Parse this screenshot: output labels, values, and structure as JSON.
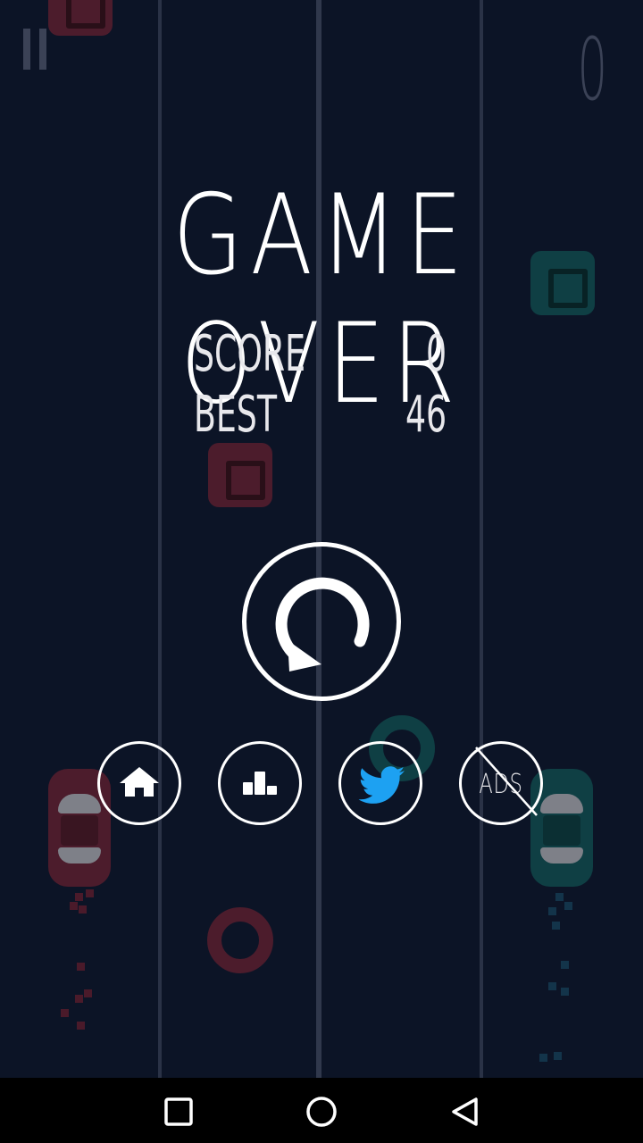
{
  "hud": {
    "pause_icon": "pause-icon",
    "current_score": "0"
  },
  "game_over": {
    "title": "GAME OVER",
    "score_label": "SCORE",
    "score_value": "0",
    "best_label": "BEST",
    "best_value": "46"
  },
  "buttons": {
    "replay_icon": "replay-icon",
    "home_icon": "home-icon",
    "leaderboard_icon": "leaderboard-icon",
    "twitter_icon": "twitter-icon",
    "remove_ads_label": "ADS"
  },
  "navbar": {
    "items": [
      "recents-icon",
      "home-circle-icon",
      "back-triangle-icon"
    ]
  },
  "colors": {
    "background": "#0c1426",
    "accent_red": "#4c1c2c",
    "accent_teal": "#0f3f44",
    "twitter_blue": "#1da1f2"
  }
}
